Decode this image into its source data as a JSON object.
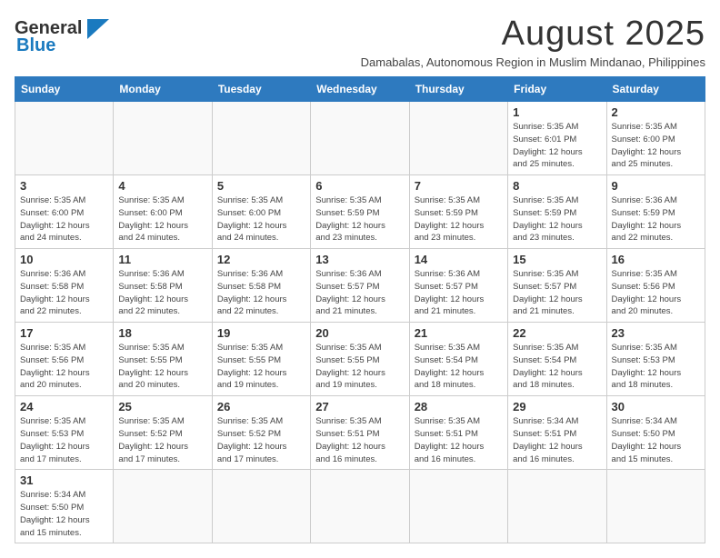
{
  "header": {
    "logo_line1": "General",
    "logo_line2": "Blue",
    "title": "August 2025",
    "subtitle": "Damabalas, Autonomous Region in Muslim Mindanao, Philippines"
  },
  "weekdays": [
    "Sunday",
    "Monday",
    "Tuesday",
    "Wednesday",
    "Thursday",
    "Friday",
    "Saturday"
  ],
  "weeks": [
    [
      {
        "day": "",
        "info": ""
      },
      {
        "day": "",
        "info": ""
      },
      {
        "day": "",
        "info": ""
      },
      {
        "day": "",
        "info": ""
      },
      {
        "day": "",
        "info": ""
      },
      {
        "day": "1",
        "info": "Sunrise: 5:35 AM\nSunset: 6:01 PM\nDaylight: 12 hours\nand 25 minutes."
      },
      {
        "day": "2",
        "info": "Sunrise: 5:35 AM\nSunset: 6:00 PM\nDaylight: 12 hours\nand 25 minutes."
      }
    ],
    [
      {
        "day": "3",
        "info": "Sunrise: 5:35 AM\nSunset: 6:00 PM\nDaylight: 12 hours\nand 24 minutes."
      },
      {
        "day": "4",
        "info": "Sunrise: 5:35 AM\nSunset: 6:00 PM\nDaylight: 12 hours\nand 24 minutes."
      },
      {
        "day": "5",
        "info": "Sunrise: 5:35 AM\nSunset: 6:00 PM\nDaylight: 12 hours\nand 24 minutes."
      },
      {
        "day": "6",
        "info": "Sunrise: 5:35 AM\nSunset: 5:59 PM\nDaylight: 12 hours\nand 23 minutes."
      },
      {
        "day": "7",
        "info": "Sunrise: 5:35 AM\nSunset: 5:59 PM\nDaylight: 12 hours\nand 23 minutes."
      },
      {
        "day": "8",
        "info": "Sunrise: 5:35 AM\nSunset: 5:59 PM\nDaylight: 12 hours\nand 23 minutes."
      },
      {
        "day": "9",
        "info": "Sunrise: 5:36 AM\nSunset: 5:59 PM\nDaylight: 12 hours\nand 22 minutes."
      }
    ],
    [
      {
        "day": "10",
        "info": "Sunrise: 5:36 AM\nSunset: 5:58 PM\nDaylight: 12 hours\nand 22 minutes."
      },
      {
        "day": "11",
        "info": "Sunrise: 5:36 AM\nSunset: 5:58 PM\nDaylight: 12 hours\nand 22 minutes."
      },
      {
        "day": "12",
        "info": "Sunrise: 5:36 AM\nSunset: 5:58 PM\nDaylight: 12 hours\nand 22 minutes."
      },
      {
        "day": "13",
        "info": "Sunrise: 5:36 AM\nSunset: 5:57 PM\nDaylight: 12 hours\nand 21 minutes."
      },
      {
        "day": "14",
        "info": "Sunrise: 5:36 AM\nSunset: 5:57 PM\nDaylight: 12 hours\nand 21 minutes."
      },
      {
        "day": "15",
        "info": "Sunrise: 5:35 AM\nSunset: 5:57 PM\nDaylight: 12 hours\nand 21 minutes."
      },
      {
        "day": "16",
        "info": "Sunrise: 5:35 AM\nSunset: 5:56 PM\nDaylight: 12 hours\nand 20 minutes."
      }
    ],
    [
      {
        "day": "17",
        "info": "Sunrise: 5:35 AM\nSunset: 5:56 PM\nDaylight: 12 hours\nand 20 minutes."
      },
      {
        "day": "18",
        "info": "Sunrise: 5:35 AM\nSunset: 5:55 PM\nDaylight: 12 hours\nand 20 minutes."
      },
      {
        "day": "19",
        "info": "Sunrise: 5:35 AM\nSunset: 5:55 PM\nDaylight: 12 hours\nand 19 minutes."
      },
      {
        "day": "20",
        "info": "Sunrise: 5:35 AM\nSunset: 5:55 PM\nDaylight: 12 hours\nand 19 minutes."
      },
      {
        "day": "21",
        "info": "Sunrise: 5:35 AM\nSunset: 5:54 PM\nDaylight: 12 hours\nand 18 minutes."
      },
      {
        "day": "22",
        "info": "Sunrise: 5:35 AM\nSunset: 5:54 PM\nDaylight: 12 hours\nand 18 minutes."
      },
      {
        "day": "23",
        "info": "Sunrise: 5:35 AM\nSunset: 5:53 PM\nDaylight: 12 hours\nand 18 minutes."
      }
    ],
    [
      {
        "day": "24",
        "info": "Sunrise: 5:35 AM\nSunset: 5:53 PM\nDaylight: 12 hours\nand 17 minutes."
      },
      {
        "day": "25",
        "info": "Sunrise: 5:35 AM\nSunset: 5:52 PM\nDaylight: 12 hours\nand 17 minutes."
      },
      {
        "day": "26",
        "info": "Sunrise: 5:35 AM\nSunset: 5:52 PM\nDaylight: 12 hours\nand 17 minutes."
      },
      {
        "day": "27",
        "info": "Sunrise: 5:35 AM\nSunset: 5:51 PM\nDaylight: 12 hours\nand 16 minutes."
      },
      {
        "day": "28",
        "info": "Sunrise: 5:35 AM\nSunset: 5:51 PM\nDaylight: 12 hours\nand 16 minutes."
      },
      {
        "day": "29",
        "info": "Sunrise: 5:34 AM\nSunset: 5:51 PM\nDaylight: 12 hours\nand 16 minutes."
      },
      {
        "day": "30",
        "info": "Sunrise: 5:34 AM\nSunset: 5:50 PM\nDaylight: 12 hours\nand 15 minutes."
      }
    ],
    [
      {
        "day": "31",
        "info": "Sunrise: 5:34 AM\nSunset: 5:50 PM\nDaylight: 12 hours\nand 15 minutes."
      },
      {
        "day": "",
        "info": ""
      },
      {
        "day": "",
        "info": ""
      },
      {
        "day": "",
        "info": ""
      },
      {
        "day": "",
        "info": ""
      },
      {
        "day": "",
        "info": ""
      },
      {
        "day": "",
        "info": ""
      }
    ]
  ]
}
